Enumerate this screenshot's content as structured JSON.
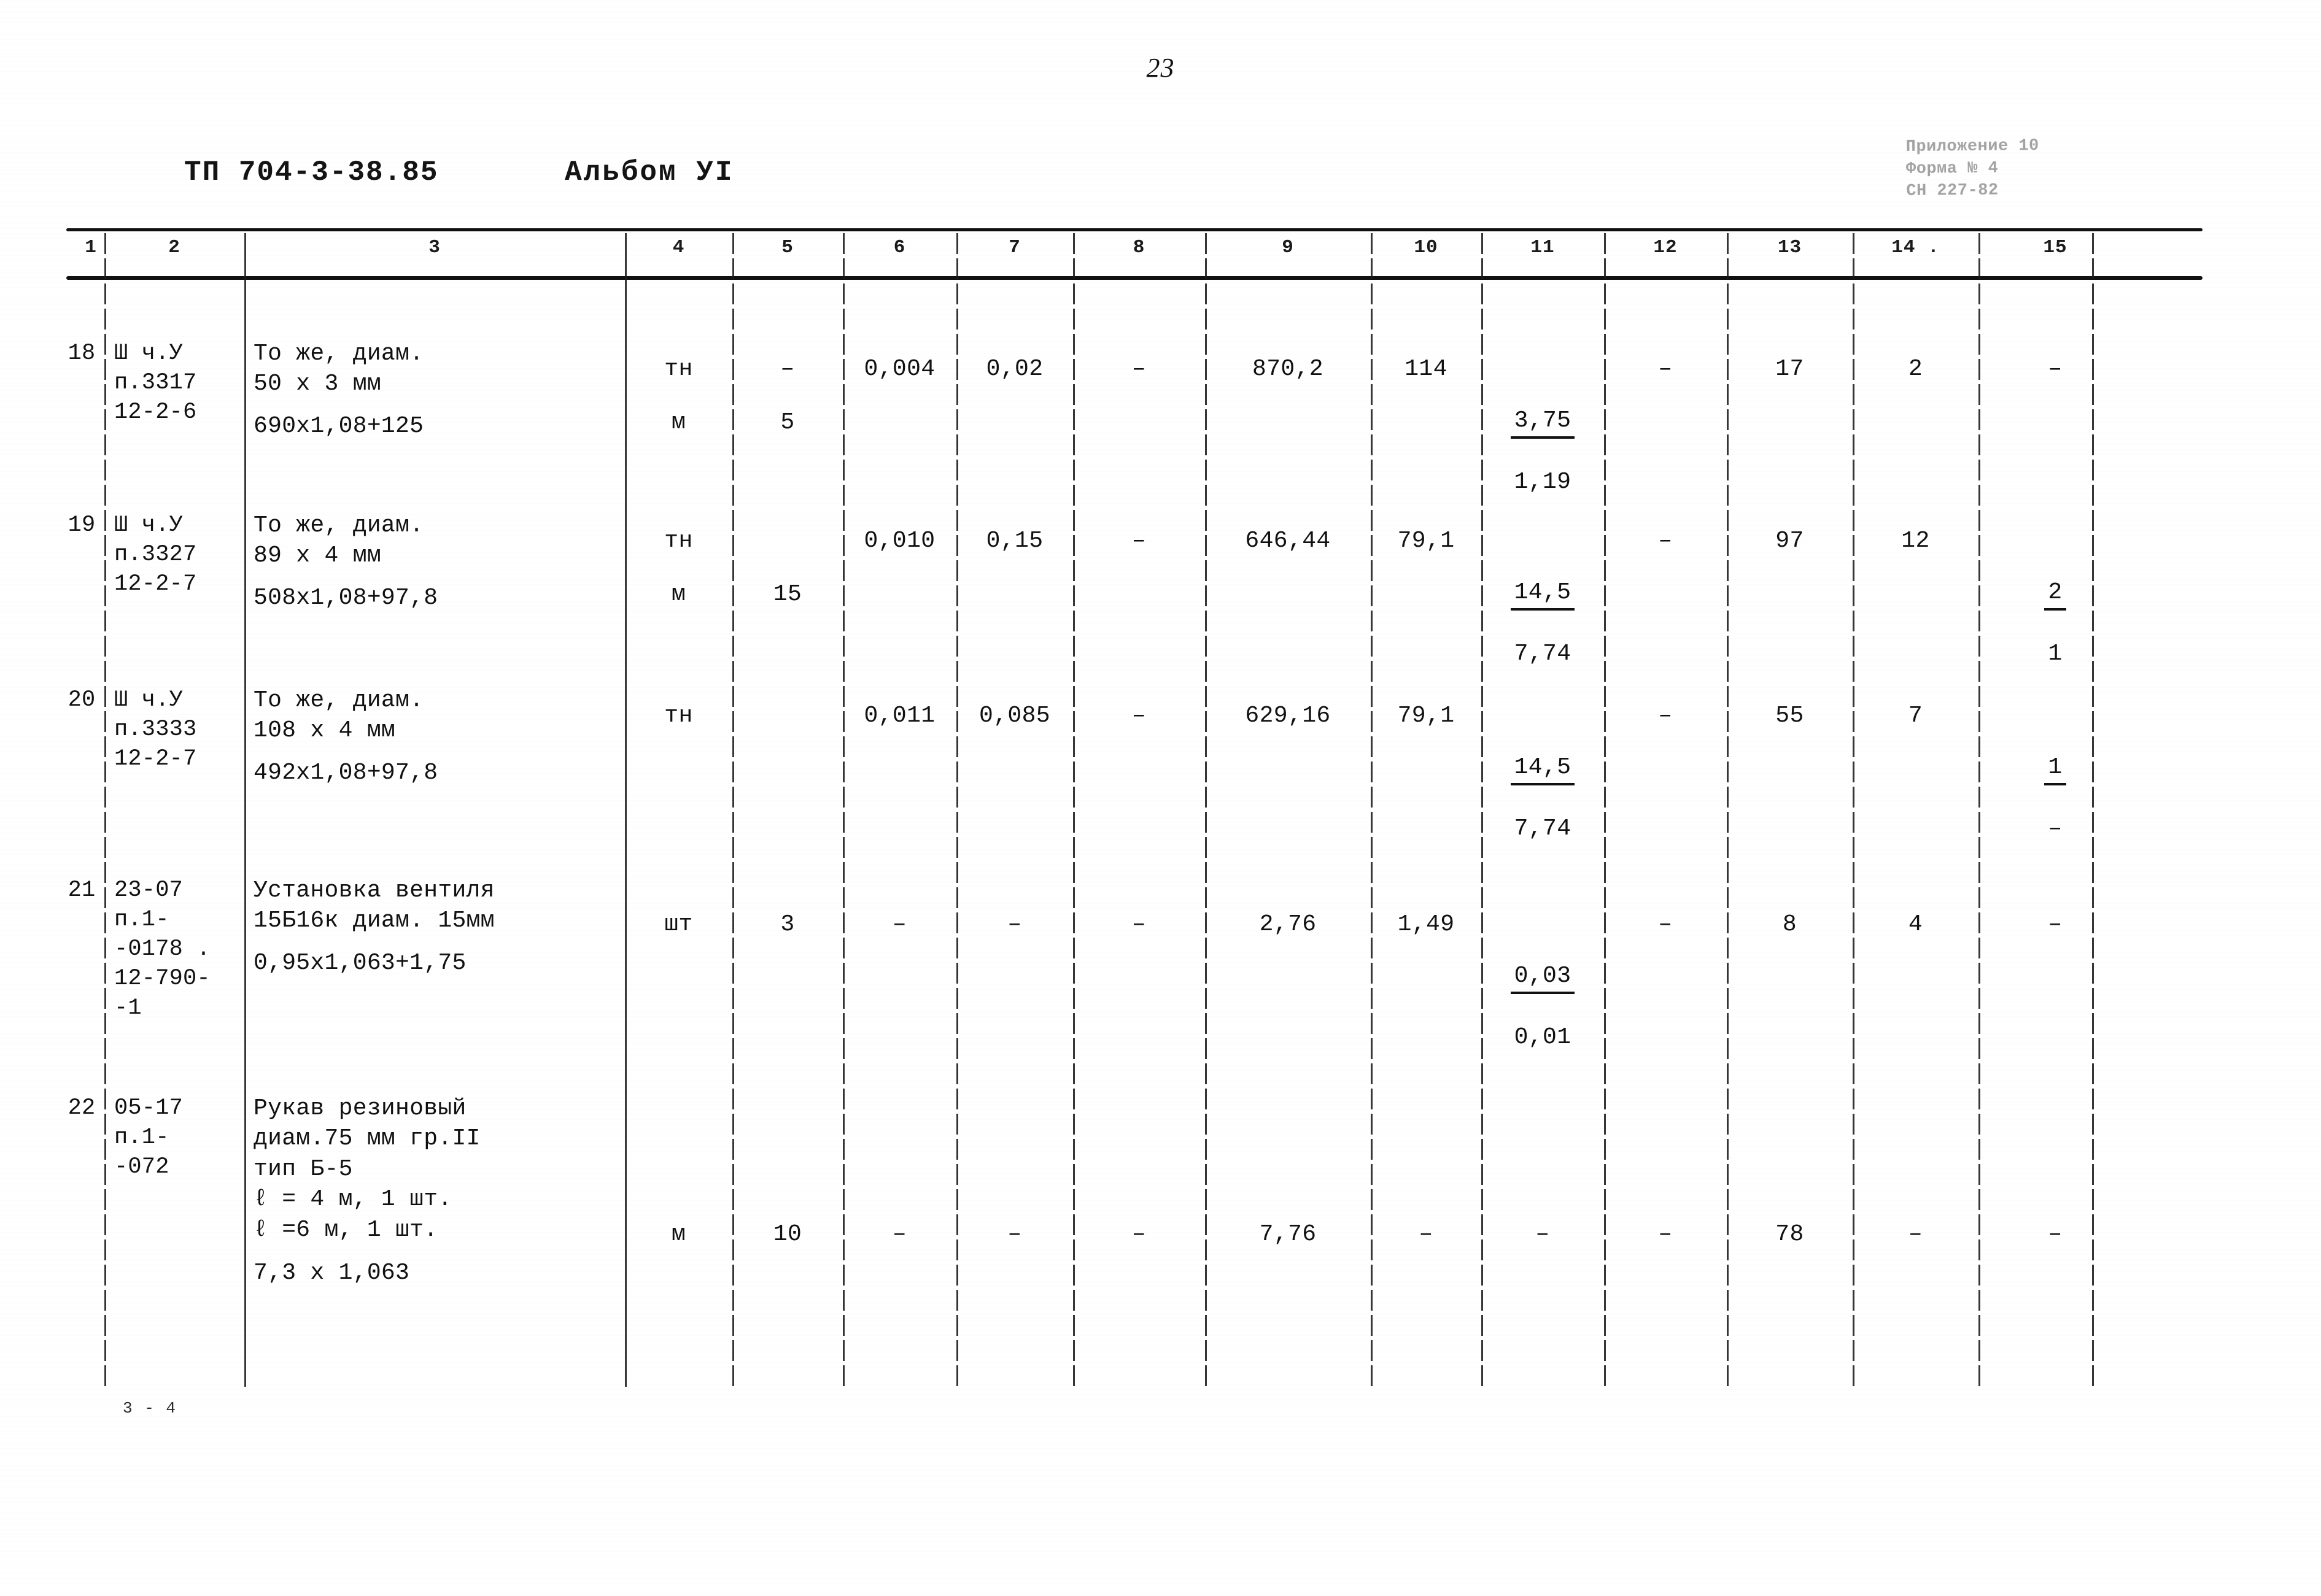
{
  "page": {
    "number": "23"
  },
  "header": {
    "document_code": "ТП 704-3-38.85",
    "album": "Альбом УI"
  },
  "stamp": {
    "line1": "Приложение 10",
    "line2": "Форма № 4",
    "line3": "СН 227-82"
  },
  "table": {
    "column_numbers": [
      "1",
      "2",
      "3",
      "4",
      "5",
      "6",
      "7",
      "8",
      "9",
      "10",
      "11",
      "12",
      "13",
      "14 .",
      "15"
    ],
    "rows": [
      {
        "num": "18",
        "code": "Ш ч.У\nп.3317\n12-2-6",
        "description": "То же, диам.\n50 х 3 мм",
        "formula": "690х1,08+125",
        "unit_top": "тн",
        "unit_bottom": "м",
        "c5_top": "–",
        "c5_bottom": "5",
        "c6": "0,004",
        "c7": "0,02",
        "c8": "–",
        "c9": "870,2",
        "c10": "114",
        "c11_top": "3,75",
        "c11_bottom": "1,19",
        "c12": "–",
        "c13": "17",
        "c14": "2",
        "c15": "–"
      },
      {
        "num": "19",
        "code": "Ш ч.У\nп.3327\n12-2-7",
        "description": "То же, диам.\n89 х 4 мм",
        "formula": "508х1,08+97,8",
        "unit_top": "тн",
        "unit_bottom": "м",
        "c5_top": "",
        "c5_bottom": "15",
        "c6": "0,010",
        "c7": "0,15",
        "c8": "–",
        "c9": "646,44",
        "c10": "79,1",
        "c11_top": "14,5",
        "c11_bottom": "7,74",
        "c12": "–",
        "c13": "97",
        "c14": "12",
        "c15_top": "2",
        "c15_bottom": "1"
      },
      {
        "num": "20",
        "code": "Ш ч.У\nп.3333\n12-2-7",
        "description": "То же, диам.\n108 х 4 мм",
        "formula": "492х1,08+97,8",
        "unit_top": "тн",
        "unit_bottom": "",
        "c5_top": "",
        "c5_bottom": "",
        "c6": "0,011",
        "c7": "0,085",
        "c8": "–",
        "c9": "629,16",
        "c10": "79,1",
        "c11_top": "14,5",
        "c11_bottom": "7,74",
        "c12": "–",
        "c13": "55",
        "c14": "7",
        "c15_top": "1",
        "c15_bottom": "–"
      },
      {
        "num": "21",
        "code": "23-07\nп.1-\n-0178 .\n12-790-\n-1",
        "description": "Установка вентиля\n15Б16к диам. 15мм",
        "formula": "0,95х1,063+1,75",
        "unit_top": "шт",
        "unit_bottom": "",
        "c5_top": "3",
        "c5_bottom": "",
        "c6": "–",
        "c7": "–",
        "c8": "–",
        "c9": "2,76",
        "c10": "1,49",
        "c11_top": "0,03",
        "c11_bottom": "0,01",
        "c12": "–",
        "c13": "8",
        "c14": "4",
        "c15": "–"
      },
      {
        "num": "22",
        "code": "05-17\nп.1-\n-072",
        "description": "Рукав резиновый\nдиам.75 мм гр.II\nтип Б-5\nℓ = 4 м,  1 шт.\nℓ =6 м,   1 шт.",
        "formula": "7,3 х 1,063",
        "unit_top": "м",
        "unit_bottom": "",
        "c5_top": "10",
        "c5_bottom": "",
        "c6": "–",
        "c7": "–",
        "c8": "–",
        "c9": "7,76",
        "c10": "–",
        "c11_top": "–",
        "c11_bottom": "",
        "c12": "–",
        "c13": "78",
        "c14": "–",
        "c15": "–"
      }
    ]
  },
  "footnote": {
    "text": "3 - 4"
  }
}
